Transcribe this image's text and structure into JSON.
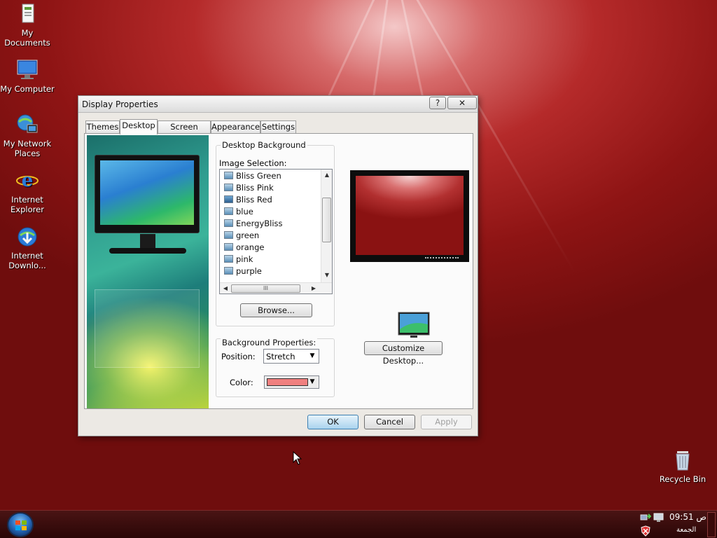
{
  "desktop": {
    "icons": [
      {
        "label": "My Documents",
        "icon": "folder-icon"
      },
      {
        "label": "My Computer",
        "icon": "computer-icon"
      },
      {
        "label": "My Network Places",
        "icon": "network-icon"
      },
      {
        "label": "Internet Explorer",
        "icon": "ie-icon"
      },
      {
        "label": "Internet Downlo...",
        "icon": "download-manager-icon"
      }
    ],
    "recycle_bin": {
      "label": "Recycle Bin",
      "icon": "recycle-bin-icon"
    }
  },
  "window": {
    "title": "Display Properties",
    "help_label": "?",
    "close_label": "✕",
    "tabs": [
      {
        "label": "Themes"
      },
      {
        "label": "Desktop",
        "active": true
      },
      {
        "label": "Screen Saver"
      },
      {
        "label": "Appearance"
      },
      {
        "label": "Settings"
      }
    ],
    "desktop_background": {
      "group_title": "Desktop Background",
      "image_selection_label": "Image Selection:",
      "items": [
        {
          "label": "Bliss Green"
        },
        {
          "label": "Bliss Pink"
        },
        {
          "label": "Bliss Red",
          "selected": true
        },
        {
          "label": "blue"
        },
        {
          "label": "EnergyBliss"
        },
        {
          "label": "green"
        },
        {
          "label": "orange"
        },
        {
          "label": "pink"
        },
        {
          "label": "purple"
        }
      ],
      "scroll_grip": "III",
      "browse_label": "Browse..."
    },
    "background_properties": {
      "group_title": "Background Properties:",
      "position_label": "Position:",
      "position_value": "Stretch",
      "color_label": "Color:",
      "color_value": "#f08080"
    },
    "customize_label": "Customize Desktop...",
    "buttons": {
      "ok": "OK",
      "cancel": "Cancel",
      "apply": "Apply"
    }
  },
  "taskbar": {
    "time": "09:51 ص",
    "day": "الجمعة"
  }
}
